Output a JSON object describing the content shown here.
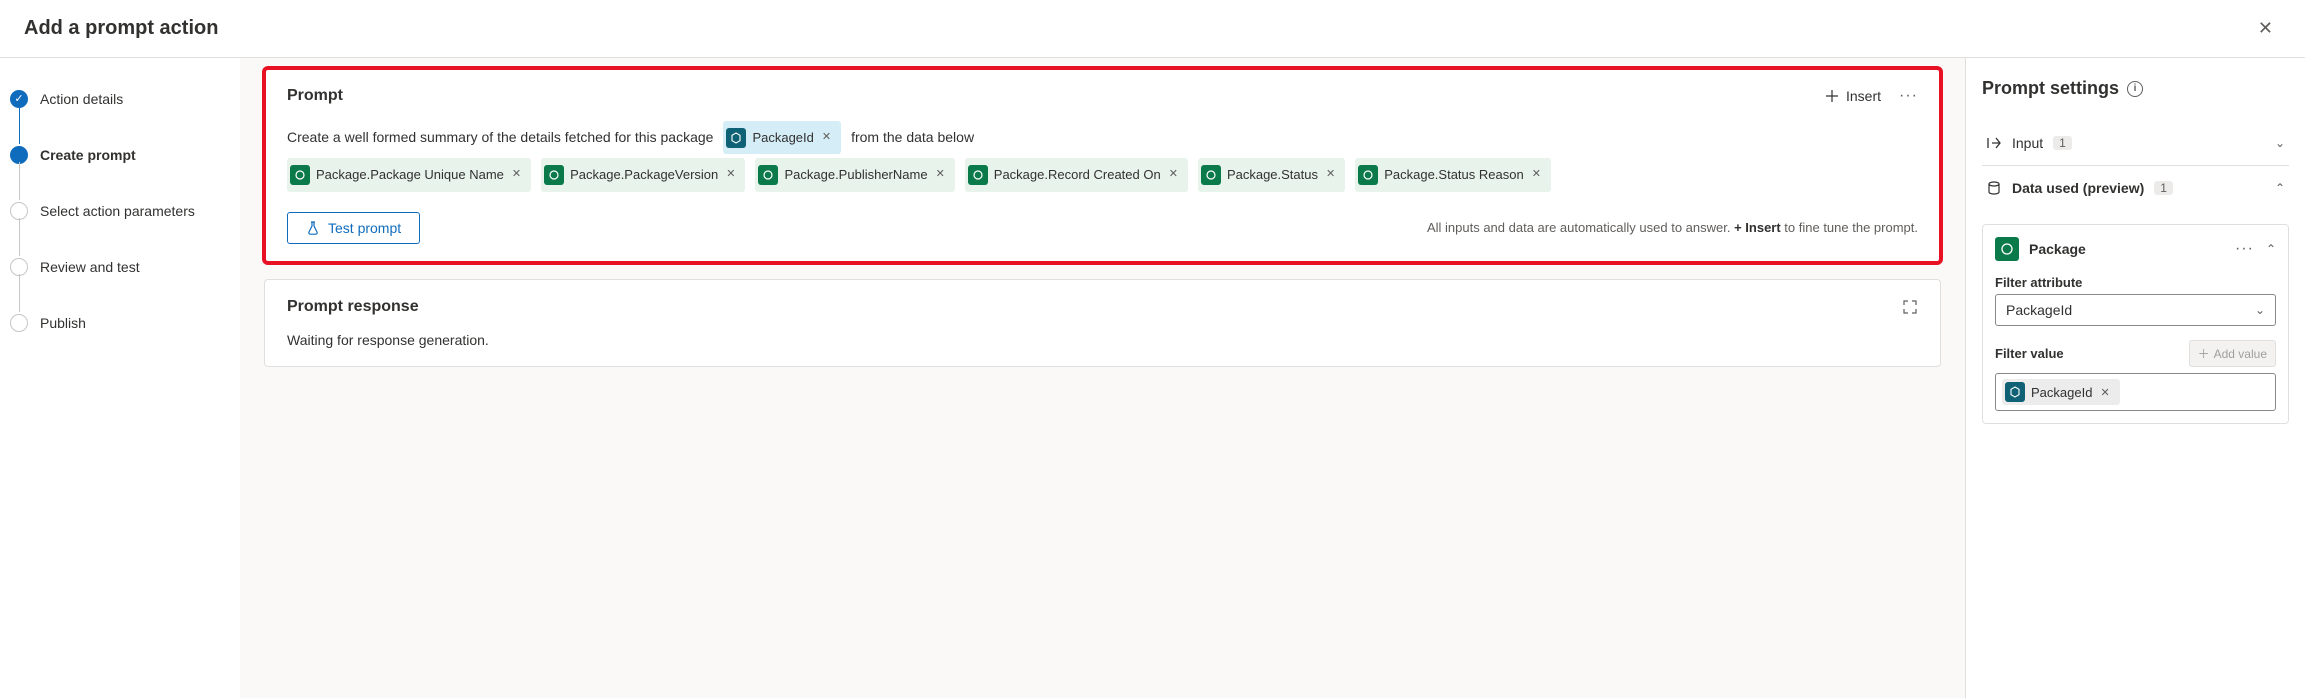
{
  "header": {
    "title": "Add a prompt action"
  },
  "steps": [
    {
      "label": "Action details"
    },
    {
      "label": "Create prompt"
    },
    {
      "label": "Select action parameters"
    },
    {
      "label": "Review and test"
    },
    {
      "label": "Publish"
    }
  ],
  "prompt_card": {
    "title": "Prompt",
    "insert_label": "Insert",
    "text_before": "Create a well formed summary of the details fetched for this package",
    "input_chip": "PackageId",
    "text_after": "from the data below",
    "chips": [
      "Package.Package Unique Name",
      "Package.PackageVersion",
      "Package.PublisherName",
      "Package.Record Created On",
      "Package.Status",
      "Package.Status Reason"
    ],
    "test_label": "Test prompt",
    "hint_before": "All inputs and data are automatically used to answer. ",
    "hint_bold": "+ Insert",
    "hint_after": " to fine tune the prompt."
  },
  "response_card": {
    "title": "Prompt response",
    "body": "Waiting for response generation."
  },
  "right": {
    "title": "Prompt settings",
    "input_section": "Input",
    "input_count": "1",
    "data_section": "Data used (preview)",
    "data_count": "1",
    "data_table": "Package",
    "filter_attr_label": "Filter attribute",
    "filter_attr_value": "PackageId",
    "filter_value_label": "Filter value",
    "add_value_label": "Add value",
    "filter_value_chip": "PackageId"
  }
}
